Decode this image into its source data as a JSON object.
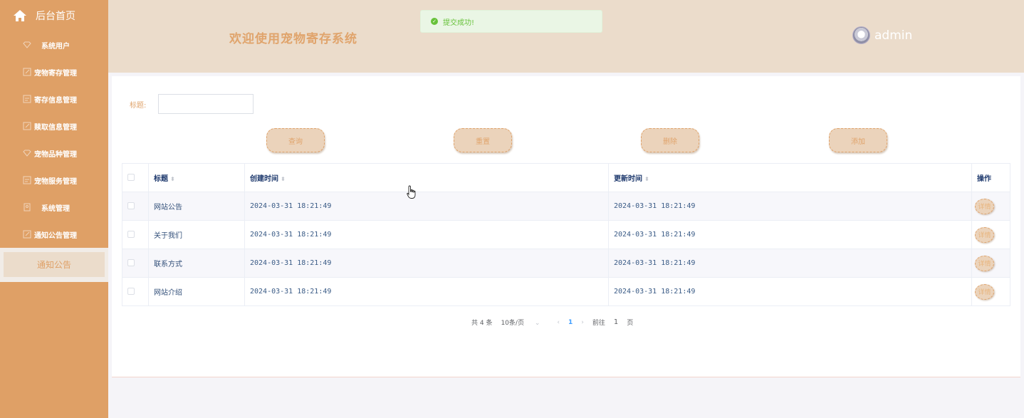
{
  "sidebar": {
    "home_label": "后台首页",
    "items": [
      {
        "label": "系统用户",
        "icon": "diamond-icon"
      },
      {
        "label": "宠物寄存管理",
        "icon": "edit-icon"
      },
      {
        "label": "寄存信息管理",
        "icon": "message-icon"
      },
      {
        "label": "赎取信息管理",
        "icon": "edit-icon"
      },
      {
        "label": "宠物品种管理",
        "icon": "diamond-icon"
      },
      {
        "label": "宠物服务管理",
        "icon": "message-icon"
      },
      {
        "label": "系统管理",
        "icon": "document-icon"
      },
      {
        "label": "通知公告管理",
        "icon": "edit-icon"
      }
    ],
    "active_sub": "通知公告"
  },
  "header": {
    "title": "欢迎使用宠物寄存系统",
    "user": "admin"
  },
  "toast": {
    "message": "提交成功!"
  },
  "search": {
    "label": "标题:",
    "value": ""
  },
  "buttons": {
    "query": "查询",
    "reset": "重置",
    "delete": "删除",
    "add": "添加"
  },
  "table": {
    "columns": [
      "标题",
      "创建时间",
      "更新时间",
      "操作"
    ],
    "rows": [
      {
        "title": "网站公告",
        "created": "2024-03-31 18:21:49",
        "updated": "2024-03-31 18:21:49",
        "action": "详情"
      },
      {
        "title": "关于我们",
        "created": "2024-03-31 18:21:49",
        "updated": "2024-03-31 18:21:49",
        "action": "详情"
      },
      {
        "title": "联系方式",
        "created": "2024-03-31 18:21:49",
        "updated": "2024-03-31 18:21:49",
        "action": "详情"
      },
      {
        "title": "网站介绍",
        "created": "2024-03-31 18:21:49",
        "updated": "2024-03-31 18:21:49",
        "action": "详情"
      }
    ]
  },
  "pagination": {
    "total": "共 4 条",
    "page_size": "10条/页",
    "current_page": "1",
    "goto_label": "前往",
    "goto_value": "1",
    "page_suffix": "页"
  },
  "colors": {
    "sidebar": "#dfa066",
    "header": "#ebdccb",
    "accent": "#e0a46c",
    "success": "#67c23a"
  }
}
